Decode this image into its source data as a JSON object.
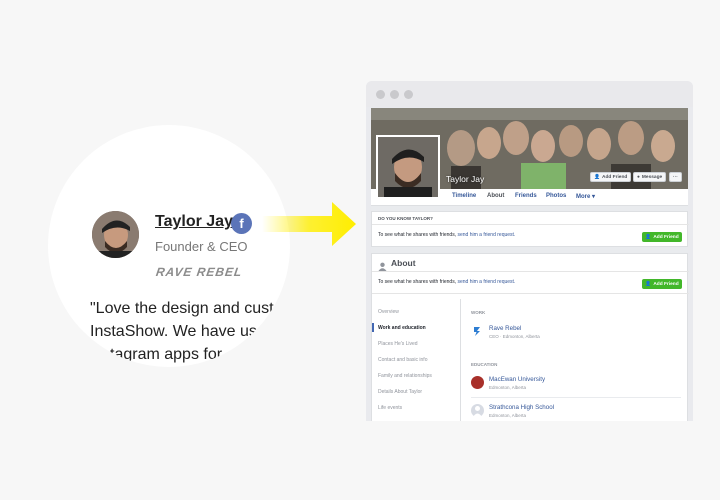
{
  "testimonial": {
    "name": "Taylor Jay",
    "role": "Founder & CEO",
    "brand_logo_text": "RAVE REBEL",
    "quote_line1": "\"Love the design and cust",
    "quote_line2": "InstaShow. We have use",
    "quote_line3": "tagram apps for",
    "social_icon": "facebook-icon"
  },
  "profile": {
    "name": "Taylor Jay",
    "add_friend_label": "Add Friend",
    "message_label": "Message",
    "more_dots": "···",
    "nav": [
      "Timeline",
      "About",
      "Friends",
      "Photos",
      "More ▾"
    ]
  },
  "know_card": {
    "heading": "DO YOU KNOW TAYLOR?",
    "text_prefix": "To see what he shares with friends, ",
    "link": "send him a friend request.",
    "button": "Add Friend"
  },
  "about": {
    "title": "About",
    "text_prefix": "To see what he shares with friends, ",
    "link": "send him a friend request.",
    "button": "Add Friend",
    "menu": [
      "Overview",
      "Work and education",
      "Places He's Lived",
      "Contact and basic info",
      "Family and relationships",
      "Details About Taylor",
      "Life events"
    ],
    "work_label": "WORK",
    "work": [
      {
        "title": "Rave Rebel",
        "sub": "CEO · Edmonton, Alberta"
      }
    ],
    "education_label": "EDUCATION",
    "education": [
      {
        "title": "MacEwan University",
        "sub": "Edmonton, Alberta"
      },
      {
        "title": "Strathcona High School",
        "sub": "Edmonton, Alberta"
      }
    ]
  },
  "colors": {
    "facebook_blue": "#5b74b8",
    "link_blue": "#365899",
    "green_button": "#42b72a",
    "arrow_yellow": "#ffee00"
  }
}
